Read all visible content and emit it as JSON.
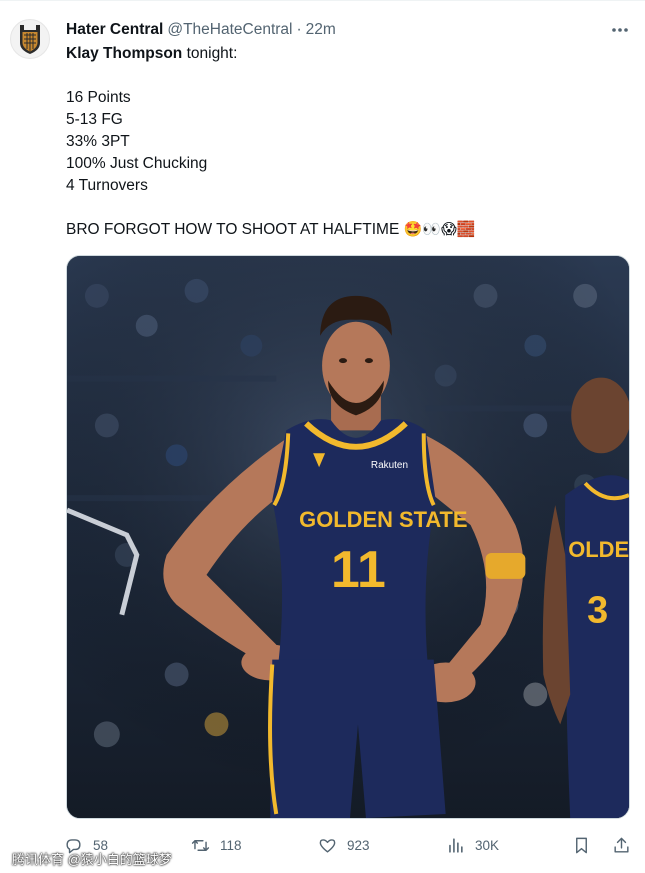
{
  "author": {
    "display_name": "Hater Central",
    "handle": "@TheHateCentral",
    "separator": "·",
    "time": "22m"
  },
  "tweet": {
    "line1_bold": "Klay Thompson",
    "line1_rest": " tonight:",
    "stats": [
      "16 Points",
      "5-13 FG",
      "33% 3PT",
      "100% Just Chucking",
      "4 Turnovers"
    ],
    "closing": "BRO FORGOT HOW TO SHOOT AT HALFTIME",
    "emojis": "🤩👀😱🧱"
  },
  "media": {
    "jersey_text": "GOLDEN STATE",
    "jersey_number": "11",
    "sponsor": "Rakuten",
    "teammate_jersey_text": "OLDEN STA",
    "teammate_number": "3",
    "colors": {
      "navy": "#1d2a5c",
      "gold": "#f2b92d",
      "skin": "#b5785a"
    }
  },
  "actions": {
    "replies": "58",
    "retweets": "118",
    "likes": "923",
    "views": "30K"
  },
  "watermark": "腾讯体育 @猿小白的篮球梦",
  "icons": {
    "avatar": "team-shield-logo",
    "more": "more-dots-icon",
    "reply": "reply-bubble-icon",
    "retweet": "retweet-icon",
    "like": "heart-icon",
    "views": "views-chart-icon",
    "bookmark": "bookmark-icon",
    "share": "share-icon"
  }
}
